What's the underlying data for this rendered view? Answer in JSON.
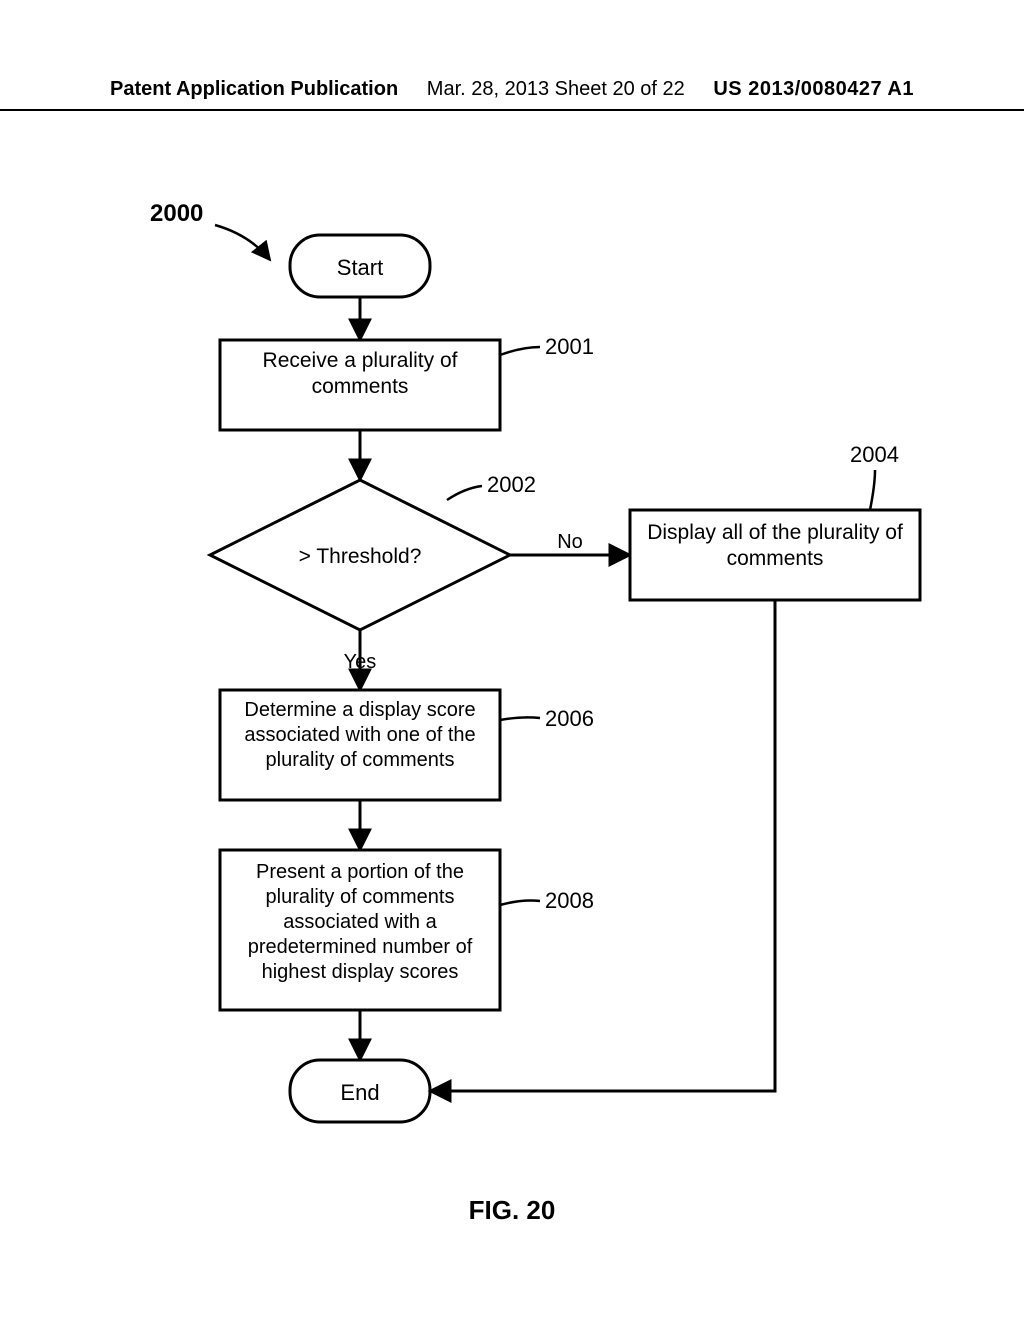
{
  "header": {
    "left": "Patent Application Publication",
    "center": "Mar. 28, 2013 Sheet 20 of 22",
    "right": "US 2013/0080427 A1"
  },
  "figure": {
    "caption": "FIG. 20",
    "ref": "2000",
    "nodes": {
      "start": {
        "label": "Start"
      },
      "n2001": {
        "label": "Receive a plurality of comments",
        "ref": "2001"
      },
      "n2002": {
        "label": "> Threshold?",
        "ref": "2002"
      },
      "n2004": {
        "label": "Display all of the plurality of comments",
        "ref": "2004"
      },
      "n2006": {
        "label": "Determine a display score associated with one of the plurality of comments",
        "ref": "2006"
      },
      "n2008": {
        "label": "Present a portion of the plurality of comments associated with a predetermined number of highest display scores",
        "ref": "2008"
      },
      "end": {
        "label": "End"
      }
    },
    "edges": {
      "yes": "Yes",
      "no": "No"
    }
  }
}
